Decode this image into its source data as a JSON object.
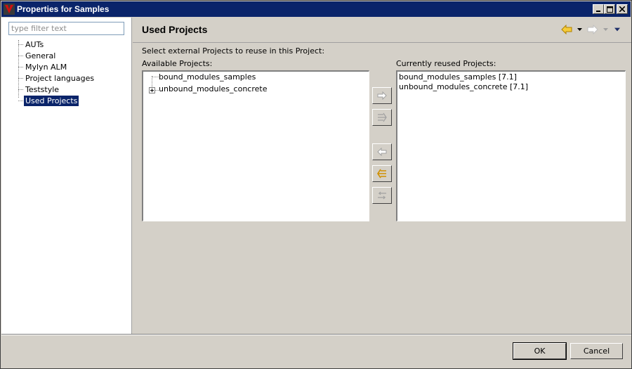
{
  "window": {
    "title": "Properties for Samples",
    "controls": {
      "minimize": "minimize-icon",
      "maximize": "maximize-icon",
      "close": "close-icon"
    }
  },
  "sidebar": {
    "filter_placeholder": "type filter text",
    "filter_value": "",
    "items": [
      {
        "label": "AUTs",
        "selected": false
      },
      {
        "label": "General",
        "selected": false
      },
      {
        "label": "Mylyn ALM",
        "selected": false
      },
      {
        "label": "Project languages",
        "selected": false
      },
      {
        "label": "Teststyle",
        "selected": false
      },
      {
        "label": "Used Projects",
        "selected": true
      }
    ]
  },
  "page": {
    "title": "Used Projects",
    "description": "Select external Projects to reuse in this Project:",
    "available_label": "Available Projects:",
    "reused_label": "Currently reused Projects:",
    "available_projects": [
      {
        "label": "bound_modules_samples",
        "expandable": false
      },
      {
        "label": "unbound_modules_concrete",
        "expandable": true
      }
    ],
    "reused_projects": [
      "bound_modules_samples [7.1]",
      "unbound_modules_concrete [7.1]"
    ],
    "move_buttons": [
      {
        "name": "add-button",
        "icon": "arrow-right-icon",
        "enabled": false
      },
      {
        "name": "add-all-button",
        "icon": "double-arrow-right-icon",
        "enabled": false
      },
      {
        "name": "remove-button",
        "icon": "arrow-left-icon",
        "enabled": false
      },
      {
        "name": "remove-all-button",
        "icon": "double-arrow-left-icon",
        "enabled": true
      },
      {
        "name": "swap-button",
        "icon": "swap-arrows-icon",
        "enabled": false
      }
    ]
  },
  "nav": {
    "back_icon": "back-arrow-icon",
    "forward_icon": "forward-arrow-icon",
    "menu_icon": "view-menu-icon"
  },
  "buttons": {
    "ok": "OK",
    "cancel": "Cancel"
  },
  "colors": {
    "titlebar": "#0a246a",
    "selection": "#0a246a",
    "arrow_active": "#e8a800",
    "arrow_disabled": "#a0a0a0"
  }
}
